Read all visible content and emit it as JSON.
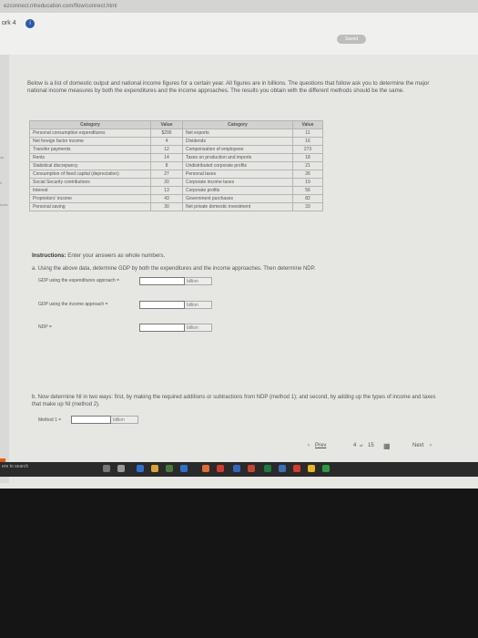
{
  "browser": {
    "url": "ezconnect.mheducation.com/flow/connect.html"
  },
  "header": {
    "work_label": "ork 4",
    "info_symbol": "i",
    "saved_label": "Saved"
  },
  "left_side": {
    "ok": "ok",
    "ll": "ll",
    "nces": "nces"
  },
  "intro_text": "Below is a list of domestic output and national income figures for a certain year. All figures are in billions. The questions that follow ask you to determine the major national income measures by both the expenditures and the income approaches. The results you obtain with the different methods should be the same.",
  "table": {
    "headers": [
      "Category",
      "Value",
      "Category",
      "Value"
    ],
    "rows": [
      [
        "Personal consumption expenditures",
        "$295",
        "Net exports",
        "11"
      ],
      [
        "Net foreign factor income",
        "4",
        "Dividends",
        "16"
      ],
      [
        "Transfer payments",
        "12",
        "Compensation of employees",
        "273"
      ],
      [
        "Rents",
        "14",
        "Taxes on production and imports",
        "18"
      ],
      [
        "Statistical discrepancy",
        "8",
        "Undistributed corporate profits",
        "21"
      ],
      [
        "Consumption of fixed capital (depreciation)",
        "27",
        "Personal taxes",
        "26"
      ],
      [
        "Social Security contributions",
        "20",
        "Corporate income taxes",
        "19"
      ],
      [
        "Interest",
        "13",
        "Corporate profits",
        "56"
      ],
      [
        "Proprietors' income",
        "43",
        "Government purchases",
        "82"
      ],
      [
        "Personal saving",
        "30",
        "Net private domestic investment",
        "33"
      ]
    ]
  },
  "instructions": {
    "bold": "Instructions:",
    "text": " Enter your answers as whole numbers."
  },
  "question_a": {
    "text": "a. Using the above data, determine GDP by both the expenditures and the income approaches. Then determine NDP.",
    "label1": "GDP using the expenditures approach =",
    "label2": "GDP using the income approach =",
    "label3": "NDP =",
    "unit": "billion"
  },
  "question_b": {
    "text": "b. Now determine NI in two ways: first, by making the required additions or subtractions from NDP (method 1); and second, by adding up the types of income and taxes that make up NI (method 2).",
    "label1": "Method 1 =",
    "unit": "billion"
  },
  "nav": {
    "prev": "Prev",
    "page_current": "4",
    "of_label": "of",
    "page_total": "15",
    "next": "Next"
  },
  "taskbar": {
    "search_text": "ere to search"
  }
}
